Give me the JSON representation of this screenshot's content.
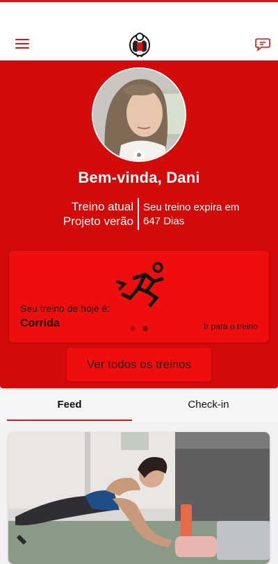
{
  "header": {
    "menu_icon": "hamburger-menu-icon",
    "logo": "gym-mascot-logo",
    "chat_icon": "chat-bubble-icon"
  },
  "profile": {
    "welcome": "Bem-vinda, Dani",
    "plan_label": "Treino atual",
    "plan_name": "Projeto verão",
    "expires_text": "Seu treino expira em",
    "expires_days": "647 Dias"
  },
  "today": {
    "label": "Seu treino de hoje é:",
    "workout": "Corrida",
    "link": "Ir para o treino",
    "icon": "running-person-icon"
  },
  "actions": {
    "all_workouts": "Ver todos os treinos"
  },
  "tabs": [
    {
      "label": "Feed",
      "active": true
    },
    {
      "label": "Check-in",
      "active": false
    }
  ],
  "colors": {
    "brand_red": "#d40b0b",
    "card_red": "#ee0e0e",
    "accent": "#d81414"
  }
}
